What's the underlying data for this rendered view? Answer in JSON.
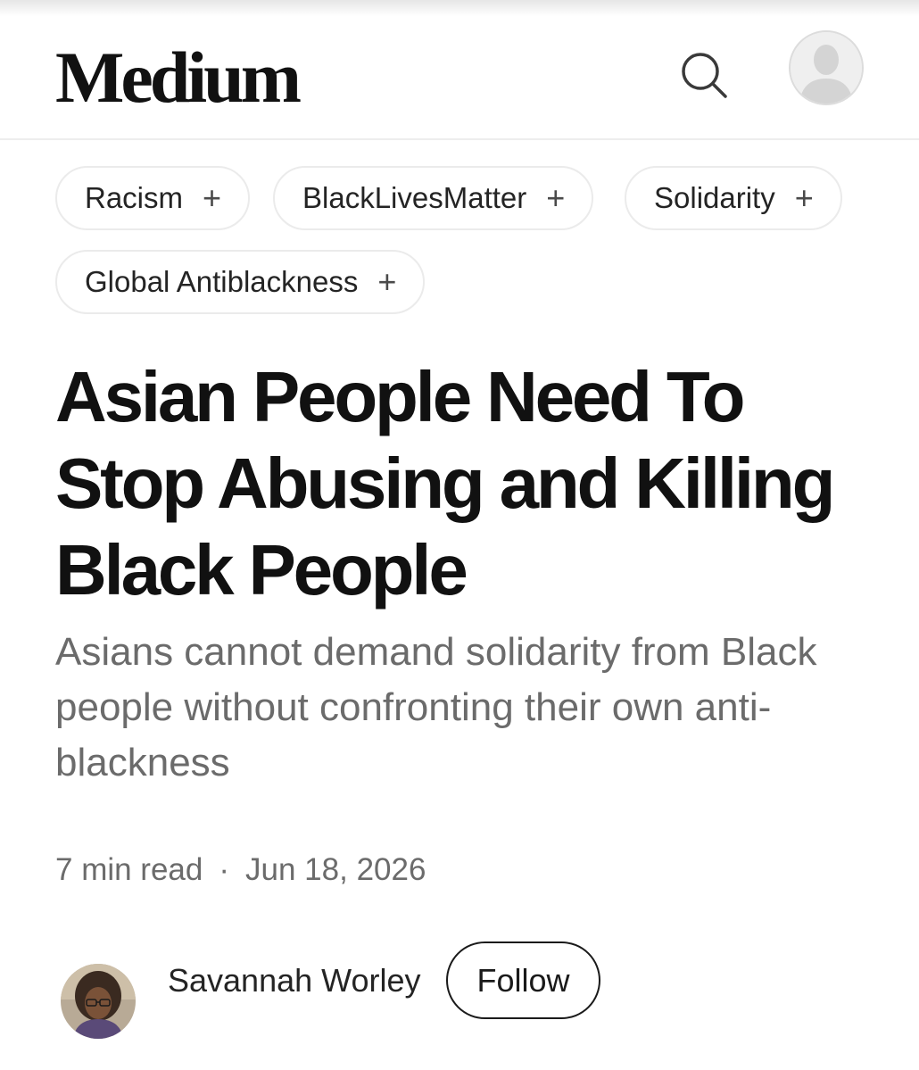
{
  "header": {
    "logo_text": "Medium",
    "search_icon": "search-icon",
    "profile_icon": "user-avatar-placeholder-icon"
  },
  "tags": [
    {
      "label": "Racism",
      "icon": "plus-icon"
    },
    {
      "label": "BlackLivesMatter",
      "icon": "plus-icon"
    },
    {
      "label": "Solidarity",
      "icon": "plus-icon"
    },
    {
      "label": "Global Antiblackness",
      "icon": "plus-icon"
    }
  ],
  "article": {
    "title": "Asian People Need To Stop Abusing and Killing Black People",
    "subtitle": "Asians cannot demand solidarity from Black people without confronting their own anti-blackness",
    "read_time": "7 min read",
    "separator": "·",
    "date": "Jun 18, 2026"
  },
  "author": {
    "name": "Savannah Worley",
    "follow_label": "Follow"
  },
  "colors": {
    "text_primary": "#111111",
    "text_secondary": "#6b6b6b",
    "tag_border": "#ebebeb",
    "divider": "#ededed"
  }
}
